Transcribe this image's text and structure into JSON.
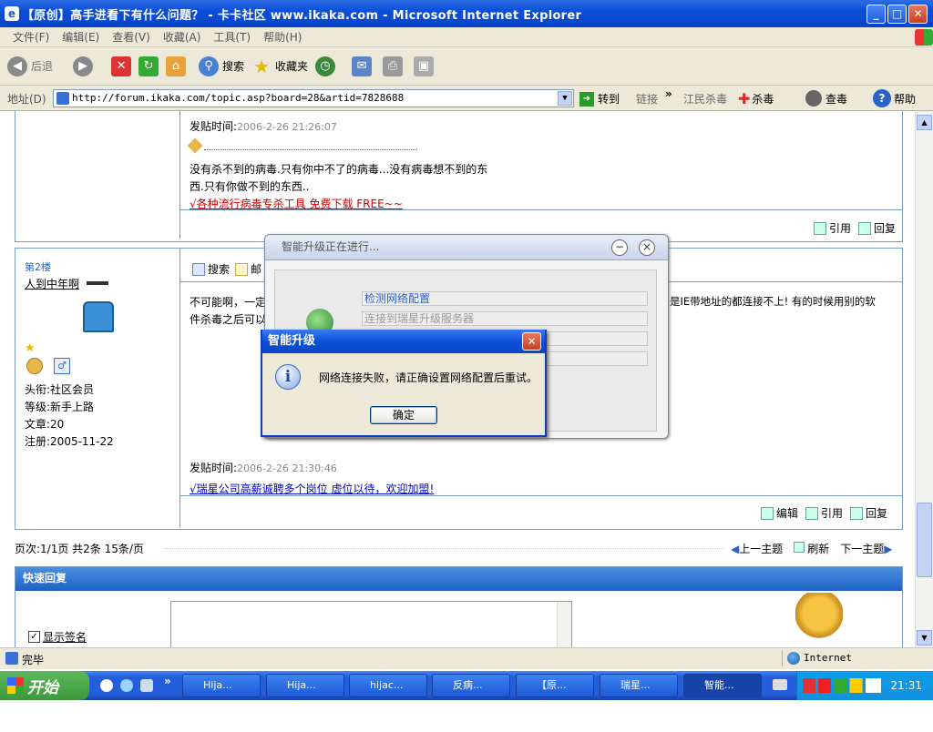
{
  "window": {
    "title": "【原创】高手进看下有什么问题？ - 卡卡社区 www.ikaka.com - Microsoft Internet Explorer"
  },
  "menu": [
    "文件(F)",
    "编辑(E)",
    "查看(V)",
    "收藏(A)",
    "工具(T)",
    "帮助(H)"
  ],
  "toolbar": {
    "back": "后退",
    "search": "搜索",
    "favorites": "收藏夹"
  },
  "address": {
    "label": "地址(D)",
    "url": "http://forum.ikaka.com/topic.asp?board=28&artid=7828688",
    "go": "转到",
    "links": "链接",
    "jiangmin": "江民杀毒",
    "kill": "杀毒",
    "scan": "查毒",
    "help": "帮助"
  },
  "post1": {
    "time_label": "发贴时间:",
    "time": "2006-2-26 21:26:07",
    "sig_line1": "没有杀不到的病毒.只有你中不了的病毒...没有病毒想不到的东",
    "sig_line2": "西.只有你做不到的东西..",
    "ad": "√各种流行病毒专杀工具 免费下载 FREE~~",
    "quote": "引用",
    "reply": "回复"
  },
  "post2": {
    "floor": "第2楼",
    "user": "人到中年啊",
    "title_label": "头衔:社区会员",
    "level": "等级:新手上路",
    "posts": "文章:20",
    "reg": "注册:2005-11-22",
    "search": "搜索",
    "mail": "邮",
    "body1": "不可能啊，一定",
    "body2": "件杀毒之后可以",
    "body_right": "是IE带地址的都连接不上! 有的时候用别的软",
    "time_label": "发贴时间:",
    "time": "2006-2-26 21:30:46",
    "ad": "√瑞星公司高薪诚聘多个岗位 虚位以待，欢迎加盟!",
    "edit": "编辑",
    "quote": "引用",
    "reply": "回复"
  },
  "pager": {
    "info": "页次:1/1页 共2条 15条/页",
    "prev": "上一主题",
    "refresh": "刷新",
    "next": "下一主题"
  },
  "quick": {
    "title": "快速回复",
    "show_sig": "显示签名"
  },
  "status": {
    "done": "完毕",
    "zone": "Internet"
  },
  "updater": {
    "title": "智能升级正在进行...",
    "step1": "检测网络配置",
    "step2": "连接到瑞星升级服务器"
  },
  "msgbox": {
    "title": "智能升级",
    "text": "网络连接失败，请正确设置网络配置后重试。",
    "ok": "确定"
  },
  "taskbar": {
    "start": "开始",
    "tasks": [
      "Hija...",
      "Hija...",
      "hijac...",
      "反病...",
      "【原...",
      "瑞星...",
      "智能..."
    ],
    "clock": "21:31"
  }
}
